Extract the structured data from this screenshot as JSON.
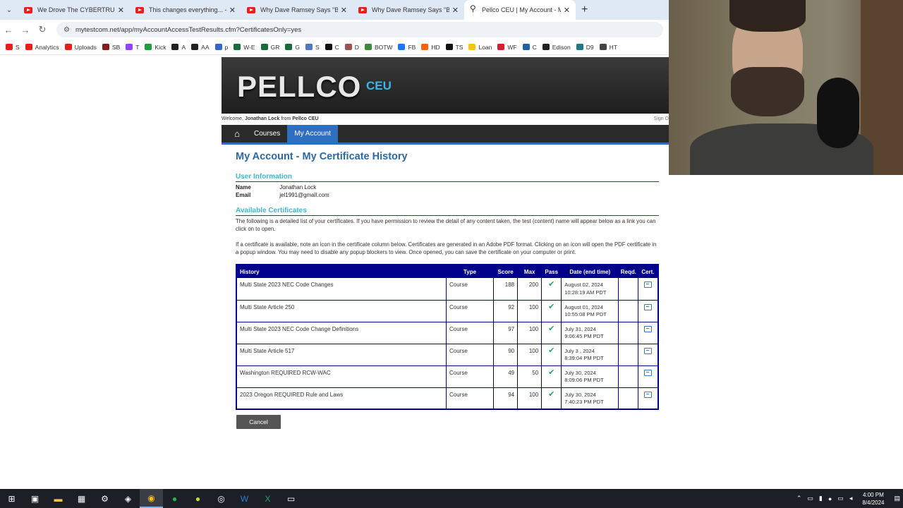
{
  "browser": {
    "tabs": [
      {
        "title": "We Drove The CYBERTRUCK Fro",
        "icon": "youtube-icon"
      },
      {
        "title": "This changes everything... - You",
        "icon": "youtube-icon"
      },
      {
        "title": "Why Dave Ramsey Says \"Better",
        "icon": "youtube-icon"
      },
      {
        "title": "Why Dave Ramsey Says \"Better",
        "icon": "youtube-icon"
      },
      {
        "title": "Pellco CEU | My Account - My C",
        "icon": "location-pin-icon",
        "active": true
      }
    ],
    "url": "mytestcom.net/app/myAccountAccessTestResults.cfm?CertificatesOnly=yes",
    "bookmarks": [
      {
        "label": "S",
        "color": "#e62117"
      },
      {
        "label": "Analytics",
        "color": "#e62117"
      },
      {
        "label": "Uploads",
        "color": "#e62117"
      },
      {
        "label": "SB",
        "color": "#8b1a1a"
      },
      {
        "label": "T",
        "color": "#9146ff"
      },
      {
        "label": "Kick",
        "color": "#1a9e3a"
      },
      {
        "label": "A",
        "color": "#222"
      },
      {
        "label": "AA",
        "color": "#222"
      },
      {
        "label": "p",
        "color": "#3366cc"
      },
      {
        "label": "W-E",
        "color": "#1a6b3a"
      },
      {
        "label": "GR",
        "color": "#1a6b3a"
      },
      {
        "label": "G",
        "color": "#1a6b3a"
      },
      {
        "label": "S",
        "color": "#4a7bc4"
      },
      {
        "label": "C",
        "color": "#111"
      },
      {
        "label": "D",
        "color": "#a05050"
      },
      {
        "label": "BOTW",
        "color": "#3a8a3a"
      },
      {
        "label": "FB",
        "color": "#1877f2"
      },
      {
        "label": "HD",
        "color": "#f96302"
      },
      {
        "label": "TS",
        "color": "#111"
      },
      {
        "label": "Loan",
        "color": "#f5c518"
      },
      {
        "label": "WF",
        "color": "#d71e28"
      },
      {
        "label": "C",
        "color": "#1f5fa8"
      },
      {
        "label": "Edison",
        "color": "#222"
      },
      {
        "label": "D9",
        "color": "#1e7a8a"
      },
      {
        "label": "HT",
        "color": "#444"
      }
    ]
  },
  "site": {
    "logo_main": "PELLCO",
    "logo_ceu": "CEU",
    "welcome_prefix": "Welcome,",
    "user_name": "Jonathan Lock",
    "welcome_from": "from",
    "org_name": "Pellco CEU",
    "sign_out": "Sign O",
    "nav": {
      "courses": "Courses",
      "my_account": "My Account"
    }
  },
  "main": {
    "title": "My Account - My Certificate History",
    "user_info_title": "User Information",
    "name_label": "Name",
    "name_value": "Jonathan Lock",
    "email_label": "Email",
    "email_value": "jel1991@gmail.com",
    "available_title": "Available Certificates",
    "para1": "The following is a detailed list of your certificates. If you have permission to review the detail of any content taken, the test (content) name will appear below as a link you can click on to open.",
    "para2": "If a certificate is available, note an icon in the certificate column below. Certificates are generated in an Adobe PDF format. Clicking on an icon will open the PDF certificate in a popup window. You may need to disable any popup blockers to view. Once opened, you can save the certificate on your computer or print.",
    "cancel_label": "Cancel"
  },
  "table": {
    "headers": {
      "history": "History",
      "type": "Type",
      "score": "Score",
      "max": "Max",
      "pass": "Pass",
      "date": "Date (end time)",
      "reqd": "Reqd.",
      "cert": "Cert."
    },
    "rows": [
      {
        "history": "Multi State 2023 NEC Code Changes",
        "type": "Course",
        "score": "188",
        "max": "200",
        "date1": "August 02, 2024",
        "date2": "10:28:19 AM PDT"
      },
      {
        "history": "Multi State Article 250",
        "type": "Course",
        "score": "92",
        "max": "100",
        "date1": "August 01, 2024",
        "date2": "10:55:08 PM PDT"
      },
      {
        "history": "Multi State 2023 NEC Code Change Definitions",
        "type": "Course",
        "score": "97",
        "max": "100",
        "date1": "July 31, 2024",
        "date2": "9:06:45 PM PDT"
      },
      {
        "history": "Multi State Article 517",
        "type": "Course",
        "score": "90",
        "max": "100",
        "date1": "July 3 , 2024",
        "date2": "8:39:04 PM PDT"
      },
      {
        "history": "Washington REQUIRED RCW-WAC",
        "type": "Course",
        "score": "49",
        "max": "50",
        "date1": "July 30, 2024",
        "date2": "8:09:06 PM PDT"
      },
      {
        "history": "2023 Oregon REQUIRED Rule and Laws",
        "type": "Course",
        "score": "94",
        "max": "100",
        "date1": "July 30, 2024",
        "date2": "7:40:23 PM PDT"
      }
    ]
  },
  "taskbar": {
    "time": "4:00 PM",
    "date": "8/4/2024"
  }
}
